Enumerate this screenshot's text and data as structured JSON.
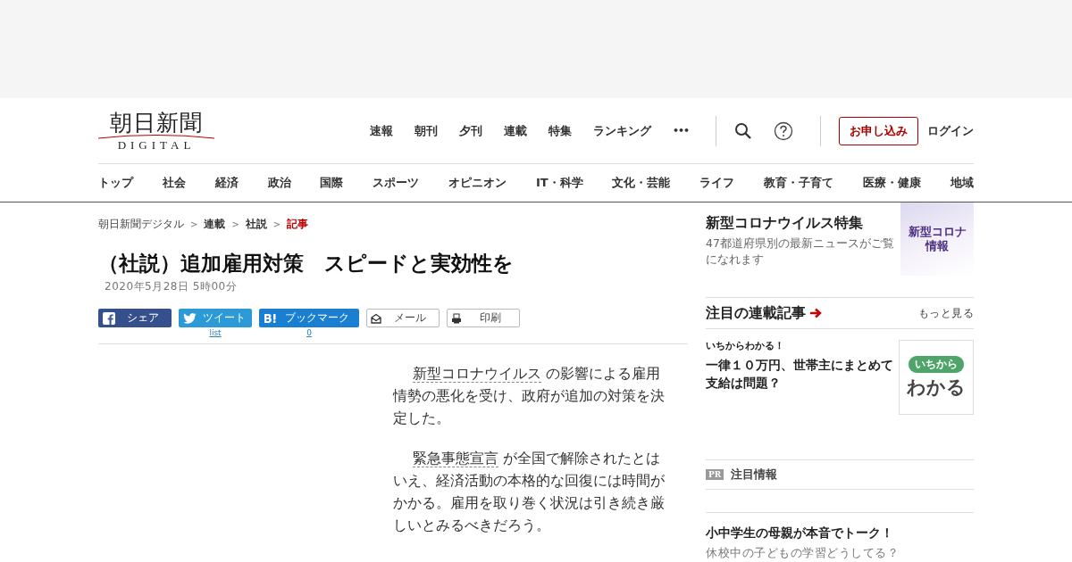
{
  "logo": {
    "title": "朝日新聞",
    "subtitle": "DIGITAL"
  },
  "top_nav": [
    "速報",
    "朝刊",
    "夕刊",
    "連載",
    "特集",
    "ランキング"
  ],
  "more": "•••",
  "header_buttons": {
    "subscribe": "お申し込み",
    "login": "ログイン"
  },
  "category_nav": [
    "トップ",
    "社会",
    "経済",
    "政治",
    "国際",
    "スポーツ",
    "オピニオン",
    "IT・科学",
    "文化・芸能",
    "ライフ",
    "教育・子育て",
    "医療・健康",
    "地域"
  ],
  "breadcrumb": [
    {
      "label": "朝日新聞デジタル",
      "current": false
    },
    {
      "label": "連載",
      "current": false
    },
    {
      "label": "社説",
      "current": false
    },
    {
      "label": "記事",
      "current": true
    }
  ],
  "breadcrumb_separator": ">",
  "article": {
    "title": "（社説）追加雇用対策　スピードと実効性を",
    "date": "2020年5月28日 5時00分",
    "share_buttons": [
      {
        "kind": "facebook",
        "label": "シェア"
      },
      {
        "kind": "twitter",
        "label": "ツイート",
        "count": "list"
      },
      {
        "kind": "hatena",
        "label": "ブックマーク",
        "count": "0"
      },
      {
        "kind": "mail",
        "label": "メール"
      },
      {
        "kind": "print",
        "label": "印刷"
      }
    ],
    "paragraphs": [
      {
        "link": "新型コロナウイルス",
        "text": " の影響による雇用情勢の悪化を受け、政府が追加の対策を決定した。"
      },
      {
        "link": "緊急事態宣言",
        "text": " が全国で解除されたとはいえ、経済活動の本格的な回復には時間がかかる。雇用を取り巻く状況は引き続き厳しいとみるべきだろう。"
      }
    ]
  },
  "sidebar": {
    "feature": {
      "title": "新型コロナウイルス特集",
      "description": "47都道府県別の最新ニュースがご覧になれます",
      "banner": [
        "新型コロナ",
        "情報"
      ]
    },
    "series": {
      "heading": "注目の連載記事",
      "more": "もっと見る",
      "items": [
        {
          "label": "いちからわかる！",
          "title": "一律１０万円、世帯主にまとめて支給は問題？",
          "badge_top": "いちから",
          "badge_bottom": "わかる"
        }
      ]
    },
    "pr": {
      "badge": "PR",
      "heading": "注目情報"
    },
    "promo": {
      "title": "小中学生の母親が本音でトーク！",
      "subtitle": "休校中の子どもの学習どうしてる？"
    }
  }
}
